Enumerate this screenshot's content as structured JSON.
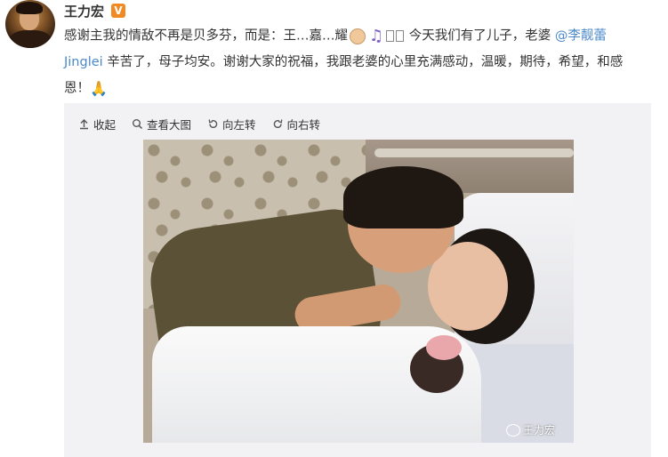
{
  "author": {
    "name": "王力宏",
    "verified_badge": "V"
  },
  "post": {
    "text_1": "感谢主我的情敌不再是贝多芬，而是：王…嘉…耀",
    "text_2": "今天我们有了儿子，老婆",
    "mention": "@李靓蕾",
    "mention_2": "Jinglei",
    "text_3": "辛苦了，母子均安。谢谢大家的祝福，我跟老婆的心里充满感动，温暖，期待，希望，和感",
    "text_4": "恩！"
  },
  "toolbar": {
    "collapse": "收起",
    "view_large": "查看大图",
    "rotate_left": "向左转",
    "rotate_right": "向右转"
  },
  "photo": {
    "watermark": "王力宏"
  },
  "colors": {
    "link": "#4c88c9",
    "verified": "#f28a24",
    "media_bg": "#f2f2f5"
  }
}
